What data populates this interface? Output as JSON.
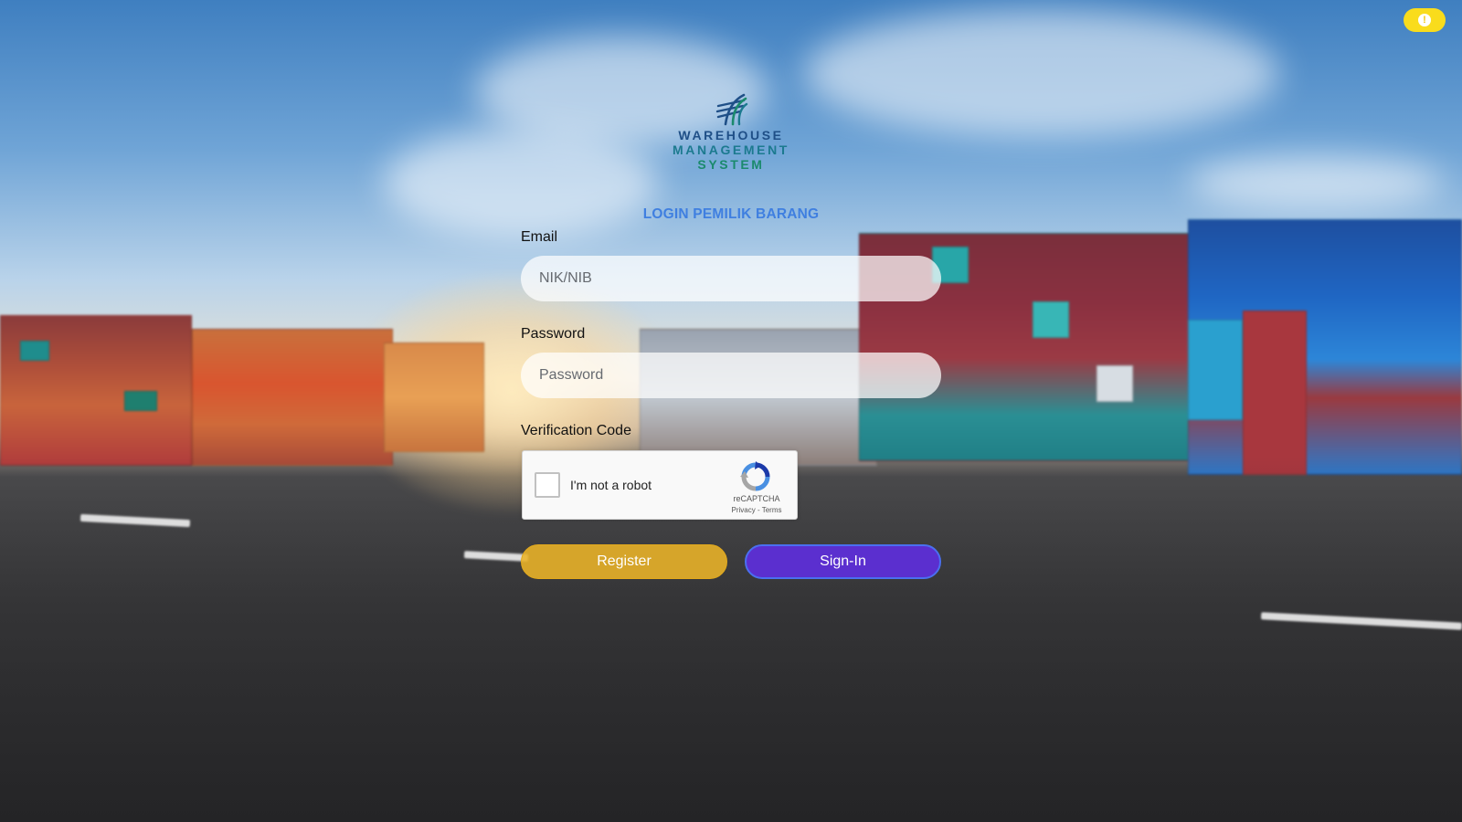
{
  "header": {
    "notice_icon": "exclamation-icon",
    "notice_glyph": "!"
  },
  "logo": {
    "line1": "WAREHOUSE",
    "line2": "MANAGEMENT",
    "line3": "SYSTEM",
    "colors": {
      "primary": "#1f4f87",
      "mid": "#1c7a8f",
      "accent": "#1b8a6d"
    }
  },
  "login": {
    "title": "LOGIN PEMILIK BARANG",
    "email": {
      "label": "Email",
      "placeholder": "NIK/NIB",
      "value": ""
    },
    "password": {
      "label": "Password",
      "placeholder": "Password",
      "value": ""
    },
    "verification": {
      "label": "Verification Code",
      "checkbox_label": "I'm not a robot",
      "brand": "reCAPTCHA",
      "privacy": "Privacy",
      "separator": " - ",
      "terms": "Terms"
    },
    "buttons": {
      "register": "Register",
      "signin": "Sign-In"
    }
  },
  "colors": {
    "title_blue": "#3f7fe0",
    "register_yellow": "#ecb428",
    "signin_purple": "#5b2fcf",
    "notice_yellow": "#f9dc1c"
  }
}
